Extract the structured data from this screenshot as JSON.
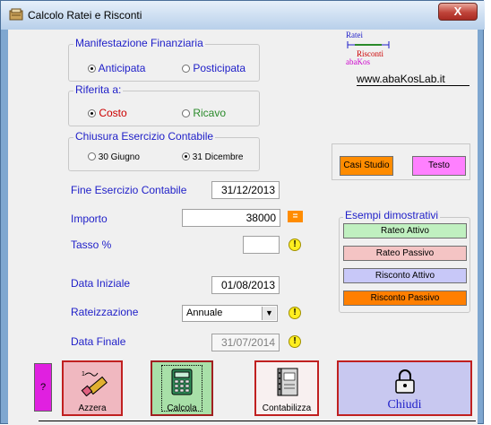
{
  "window": {
    "title": "Calcolo Ratei e Risconti",
    "close_label": "X"
  },
  "logo": {
    "line1": "Ratei",
    "line2": "Risconti",
    "line3": "abaKos",
    "url": "www.abaKosLab.it"
  },
  "manifestazione": {
    "title": "Manifestazione Finanziaria",
    "opt1": "Anticipata",
    "opt2": "Posticipata",
    "selected": "Anticipata"
  },
  "riferita": {
    "title": "Riferita a:",
    "opt1": "Costo",
    "opt2": "Ricavo",
    "selected": "Costo"
  },
  "chiusura": {
    "title": "Chiusura Esercizio Contabile",
    "opt1": "30 Giugno",
    "opt2": "31 Dicembre",
    "selected": "31 Dicembre"
  },
  "fine_esercizio": {
    "label": "Fine Esercizio Contabile",
    "value": "31/12/2013"
  },
  "importo": {
    "label": "Importo",
    "value": "38000",
    "eq_label": "="
  },
  "tasso": {
    "label": "Tasso %",
    "value": "",
    "warn": "!"
  },
  "data_iniziale": {
    "label": "Data Iniziale",
    "value": "01/08/2013"
  },
  "rateizzazione": {
    "label": "Rateizzazione",
    "value": "Annuale",
    "warn": "!"
  },
  "data_finale": {
    "label": "Data Finale",
    "value": "31/07/2014",
    "warn": "!"
  },
  "side_buttons": {
    "casi_studio": "Casi Studio",
    "testo": "Testo"
  },
  "esempi": {
    "title": "Esempi dimostrativi",
    "rateo_attivo": "Rateo Attivo",
    "rateo_passivo": "Rateo Passivo",
    "risconto_attivo": "Risconto Attivo",
    "risconto_passivo": "Risconto Passivo"
  },
  "bottom": {
    "help": "?",
    "azzera": "Azzera",
    "calcola": "Calcola",
    "contabilizza": "Contabilizza",
    "chiudi": "Chiudi"
  },
  "colors": {
    "casi_studio": "#ff8c00",
    "testo": "#ff80ff",
    "rateo_attivo": "#c0f0c0",
    "rateo_passivo": "#f4c4c4",
    "risconto_attivo": "#c8c8f8",
    "risconto_passivo": "#ff7f00"
  }
}
